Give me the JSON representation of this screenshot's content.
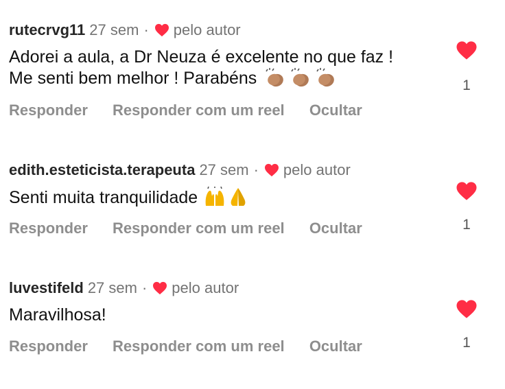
{
  "colors": {
    "heart_red": "#ff2d45",
    "username": "#262626",
    "muted": "#737373",
    "action": "#8e8e8e"
  },
  "comments": [
    {
      "username": "rutecrvg11",
      "time": "27 sem",
      "separator": "·",
      "author_like_label": "pelo autor",
      "text": "Adorei a aula, a Dr Neuza é excelente no que faz ! Me senti bem melhor ! Parabéns",
      "emojis": [
        "clapping-hands-icon",
        "clapping-hands-icon",
        "clapping-hands-icon"
      ],
      "actions": [
        "Responder",
        "Responder com um reel",
        "Ocultar"
      ],
      "like_count": "1",
      "liked": true
    },
    {
      "username": "edith.esteticista.terapeuta",
      "time": "27 sem",
      "separator": "·",
      "author_like_label": "pelo autor",
      "text": "Senti muita tranquilidade",
      "emojis": [
        "raising-hands-icon",
        "folded-hands-icon"
      ],
      "actions": [
        "Responder",
        "Responder com um reel",
        "Ocultar"
      ],
      "like_count": "1",
      "liked": true
    },
    {
      "username": "luvestifeld",
      "time": "27 sem",
      "separator": "·",
      "author_like_label": "pelo autor",
      "text": "Maravilhosa!",
      "emojis": [],
      "actions": [
        "Responder",
        "Responder com um reel",
        "Ocultar"
      ],
      "like_count": "1",
      "liked": true
    }
  ]
}
